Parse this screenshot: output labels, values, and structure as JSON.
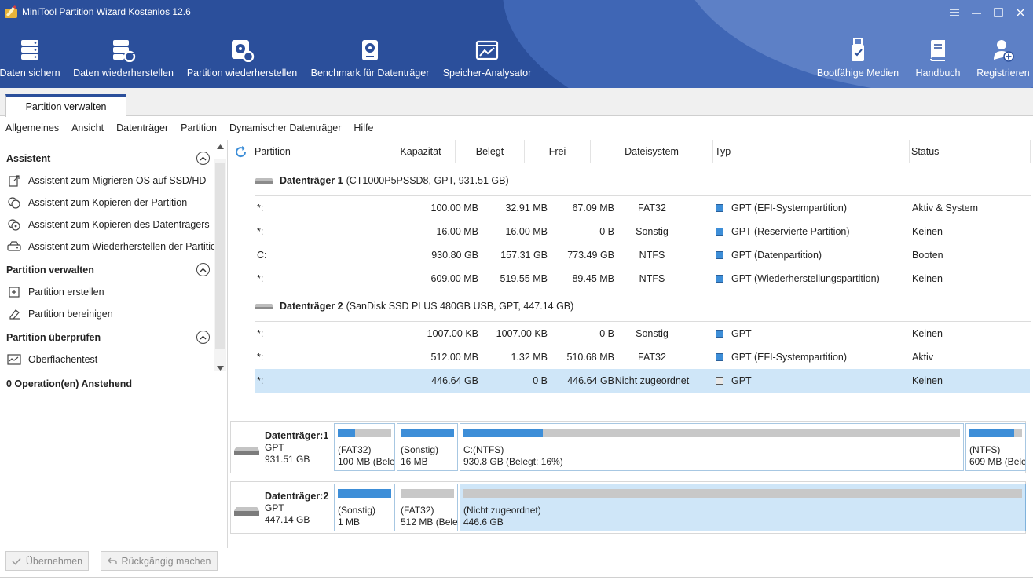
{
  "window": {
    "title": "MiniTool Partition Wizard Kostenlos 12.6"
  },
  "toolbar": {
    "left": [
      {
        "label": "Daten sichern",
        "icon": "backup-icon"
      },
      {
        "label": "Daten wiederherstellen",
        "icon": "data-recovery-icon"
      },
      {
        "label": "Partition wiederherstellen",
        "icon": "partition-recovery-icon"
      },
      {
        "label": "Benchmark für Datenträger",
        "icon": "disk-benchmark-icon"
      },
      {
        "label": "Speicher-Analysator",
        "icon": "space-analyzer-icon"
      }
    ],
    "right": [
      {
        "label": "Bootfähige Medien",
        "icon": "bootable-media-icon"
      },
      {
        "label": "Handbuch",
        "icon": "manual-icon"
      },
      {
        "label": "Registrieren",
        "icon": "register-icon"
      }
    ]
  },
  "tab": {
    "label": "Partition verwalten"
  },
  "menu": [
    "Allgemeines",
    "Ansicht",
    "Datenträger",
    "Partition",
    "Dynamischer Datenträger",
    "Hilfe"
  ],
  "sidebar": {
    "sections": [
      {
        "title": "Assistent",
        "items": [
          {
            "label": "Assistent zum Migrieren OS auf SSD/HD",
            "icon": "migrate-os-icon"
          },
          {
            "label": "Assistent zum Kopieren der Partition",
            "icon": "copy-partition-icon"
          },
          {
            "label": "Assistent zum Kopieren des Datenträgers",
            "icon": "copy-disk-icon"
          },
          {
            "label": "Assistent zum Wiederherstellen der Partition",
            "icon": "restore-partition-icon"
          }
        ]
      },
      {
        "title": "Partition verwalten",
        "items": [
          {
            "label": "Partition erstellen",
            "icon": "create-partition-icon"
          },
          {
            "label": "Partition bereinigen",
            "icon": "wipe-partition-icon"
          }
        ]
      },
      {
        "title": "Partition überprüfen",
        "items": [
          {
            "label": "Oberflächentest",
            "icon": "surface-test-icon"
          }
        ]
      }
    ],
    "pending": "0 Operation(en) Anstehend",
    "apply_label": "Übernehmen",
    "undo_label": "Rückgängig machen"
  },
  "table": {
    "columns": [
      "Partition",
      "Kapazität",
      "Belegt",
      "Frei",
      "Dateisystem",
      "Typ",
      "Status"
    ],
    "disks": [
      {
        "name": "Datenträger 1",
        "desc": "(CT1000P5PSSD8, GPT, 931.51 GB)",
        "partitions": [
          {
            "partition": "*:",
            "capacity": "100.00 MB",
            "used": "32.91 MB",
            "free": "67.09 MB",
            "fs": "FAT32",
            "type": "GPT (EFI-Systempartition)",
            "status": "Aktiv & System"
          },
          {
            "partition": "*:",
            "capacity": "16.00 MB",
            "used": "16.00 MB",
            "free": "0 B",
            "fs": "Sonstig",
            "type": "GPT (Reservierte Partition)",
            "status": "Keinen"
          },
          {
            "partition": "C:",
            "capacity": "930.80 GB",
            "used": "157.31 GB",
            "free": "773.49 GB",
            "fs": "NTFS",
            "type": "GPT (Datenpartition)",
            "status": "Booten"
          },
          {
            "partition": "*:",
            "capacity": "609.00 MB",
            "used": "519.55 MB",
            "free": "89.45 MB",
            "fs": "NTFS",
            "type": "GPT (Wiederherstellungspartition)",
            "status": "Keinen"
          }
        ]
      },
      {
        "name": "Datenträger 2",
        "desc": "(SanDisk SSD PLUS 480GB USB, GPT, 447.14 GB)",
        "partitions": [
          {
            "partition": "*:",
            "capacity": "1007.00 KB",
            "used": "1007.00 KB",
            "free": "0 B",
            "fs": "Sonstig",
            "type": "GPT",
            "status": "Keinen"
          },
          {
            "partition": "*:",
            "capacity": "512.00 MB",
            "used": "1.32 MB",
            "free": "510.68 MB",
            "fs": "FAT32",
            "type": "GPT (EFI-Systempartition)",
            "status": "Aktiv"
          },
          {
            "partition": "*:",
            "capacity": "446.64 GB",
            "used": "0 B",
            "free": "446.64 GB",
            "fs": "Nicht zugeordnet",
            "type": "GPT",
            "status": "Keinen",
            "selected": true,
            "unallocated": true
          }
        ]
      }
    ]
  },
  "diskmap": [
    {
      "title": "Datenträger:1",
      "type": "GPT",
      "size": "931.51 GB",
      "parts": [
        {
          "line1": "(FAT32)",
          "line2": "100 MB (Bele",
          "used_fraction": 0.33
        },
        {
          "line1": "(Sonstig)",
          "line2": "16 MB",
          "used_fraction": 1.0
        },
        {
          "line1": "C:(NTFS)",
          "line2": "930.8 GB (Belegt: 16%)",
          "used_fraction": 0.16
        },
        {
          "line1": "(NTFS)",
          "line2": "609 MB (Bele",
          "used_fraction": 0.85
        }
      ]
    },
    {
      "title": "Datenträger:2",
      "type": "GPT",
      "size": "447.14 GB",
      "parts": [
        {
          "line1": "(Sonstig)",
          "line2": "1 MB",
          "used_fraction": 1.0
        },
        {
          "line1": "(FAT32)",
          "line2": "512 MB (Bele",
          "used_fraction": 0.0
        },
        {
          "line1": "(Nicht zugeordnet)",
          "line2": "446.6 GB",
          "used_fraction": 0.0,
          "selected": true
        }
      ]
    }
  ],
  "colors": {
    "header": "#2b4f9b",
    "accent": "#3d8ed8",
    "selection": "#cfe6f8",
    "unallocated": "#c8c8c8"
  }
}
